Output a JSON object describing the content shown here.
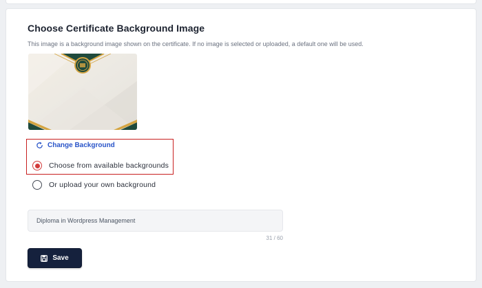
{
  "section": {
    "title": "Choose Certificate Background Image",
    "description": "This image is a background image shown on the certificate. If no image is selected or uploaded, a default one will be used."
  },
  "preview": {
    "icon": "certificate-background-thumbnail"
  },
  "change_background": {
    "label": "Change Background",
    "icon": "refresh-icon"
  },
  "options": [
    {
      "label": "Choose from available backgrounds",
      "selected": true
    },
    {
      "label": "Or upload your own background",
      "selected": false
    }
  ],
  "title_field": {
    "value": "Diploma in Wordpress Management",
    "counter": "31 / 60"
  },
  "save_button": {
    "label": "Save",
    "icon": "save-icon"
  },
  "colors": {
    "accent_blue": "#2a55c9",
    "radio_selected": "#d23a3a",
    "highlight_border": "#c81e1e",
    "button_bg": "#15213d"
  }
}
